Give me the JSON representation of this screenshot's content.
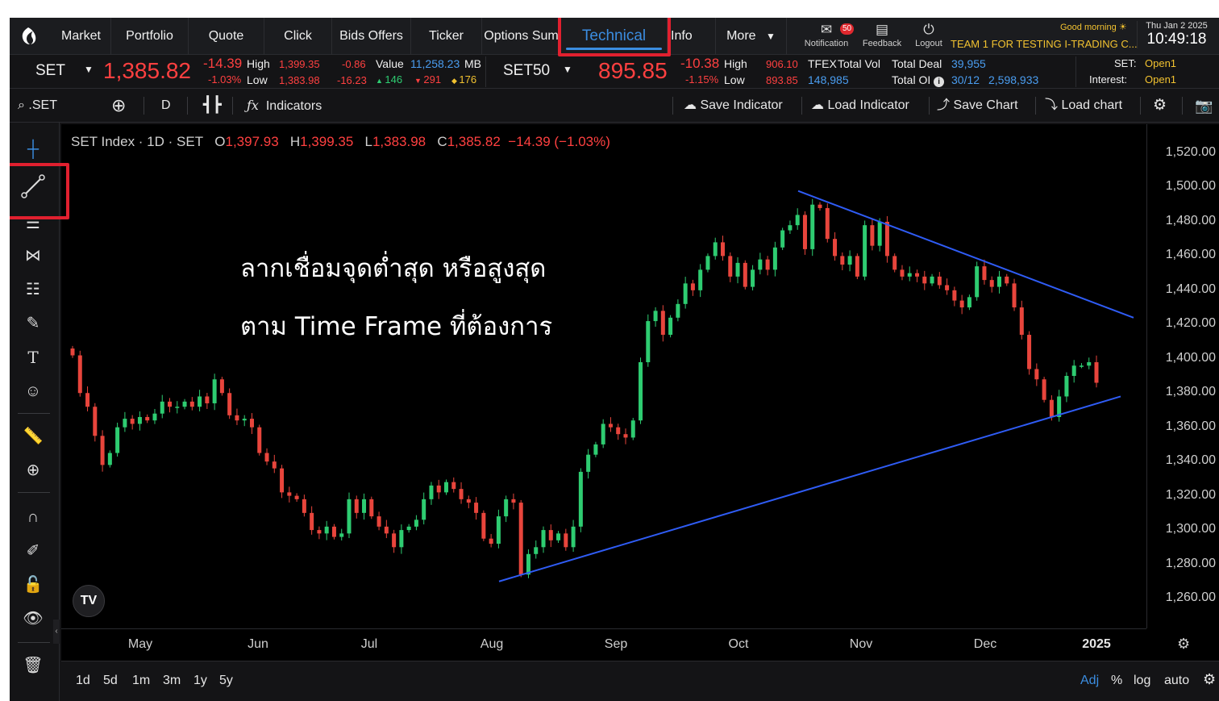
{
  "nav": {
    "items": [
      "Market",
      "Portfolio",
      "Quote",
      "Click",
      "Bids Offers",
      "Ticker",
      "Options Sum",
      "Technical",
      "Info",
      "More"
    ],
    "notification_label": "Notification",
    "notification_count": "50",
    "feedback_label": "Feedback",
    "logout_label": "Logout",
    "greeting": "Good morning",
    "team": "TEAM 1 FOR TESTING I-TRADING C...",
    "date": "Thu Jan 2 2025",
    "time": "10:49:18"
  },
  "quote": {
    "symbol": "SET",
    "last": "1,385.82",
    "change": "-14.39",
    "change_pct": "-1.03%",
    "high_label": "High",
    "high": "1,399.35",
    "low_label": "Low",
    "low": "1,383.98",
    "chg2": "-0.86",
    "chg3": "-16.23",
    "value_label": "Value",
    "value": "11,258.23",
    "value_unit": "MB",
    "up": "146",
    "down": "291",
    "unchanged": "176",
    "symbol2": "SET50",
    "last2": "895.85",
    "change2": "-10.38",
    "change2_pct": "-1.15%",
    "high2": "906.10",
    "low2": "893.85",
    "tfex_label": "TFEX",
    "total_vol_label": "Total Vol",
    "total_vol": "148,985",
    "total_deal_label": "Total Deal",
    "total_deal": "39,955",
    "total_oi_label": "Total OI",
    "total_oi_date": "30/12",
    "total_oi": "2,598,933",
    "set_label": "SET:",
    "set_status": "Open1",
    "interest_label": "Interest:",
    "interest_status": "Open1"
  },
  "toolbar": {
    "symbol_search": ".SET",
    "interval": "D",
    "indicators": "Indicators",
    "save_indicator": "Save Indicator",
    "load_indicator": "Load Indicator",
    "save_chart": "Save Chart",
    "load_chart": "Load chart"
  },
  "chart_legend": {
    "title": "SET Index · 1D · SET",
    "o_label": "O",
    "o": "1,397.93",
    "h_label": "H",
    "h": "1,399.35",
    "l_label": "L",
    "l": "1,383.98",
    "c_label": "C",
    "c": "1,385.82",
    "chg": "−14.39 (−1.03%)"
  },
  "overlay_text": {
    "line1": "ลากเชื่อมจุดต่ำสุด  หรือสูงสุด",
    "line2": "ตาม Time Frame ที่ต้องการ"
  },
  "chart_data": {
    "type": "candlestick",
    "title": "SET Index · 1D · SET",
    "x_ticks": [
      "May",
      "Jun",
      "Jul",
      "Aug",
      "Sep",
      "Oct",
      "Nov",
      "Dec",
      "2025"
    ],
    "y_ticks": [
      "1,520.00",
      "1,500.00",
      "1,480.00",
      "1,460.00",
      "1,440.00",
      "1,420.00",
      "1,400.00",
      "1,380.00",
      "1,360.00",
      "1,340.00",
      "1,320.00",
      "1,300.00",
      "1,280.00",
      "1,260.00"
    ],
    "ylim": [
      1248,
      1528
    ],
    "close_series": [
      1402,
      1380,
      1372,
      1355,
      1338,
      1345,
      1360,
      1365,
      1362,
      1366,
      1364,
      1368,
      1375,
      1372,
      1372,
      1375,
      1372,
      1378,
      1374,
      1388,
      1380,
      1367,
      1364,
      1365,
      1360,
      1345,
      1340,
      1336,
      1322,
      1320,
      1318,
      1310,
      1300,
      1298,
      1302,
      1296,
      1298,
      1318,
      1310,
      1318,
      1308,
      1302,
      1298,
      1290,
      1300,
      1302,
      1306,
      1318,
      1326,
      1322,
      1328,
      1324,
      1318,
      1316,
      1310,
      1295,
      1292,
      1308,
      1318,
      1316,
      1274,
      1286,
      1290,
      1300,
      1294,
      1298,
      1290,
      1302,
      1334,
      1344,
      1350,
      1362,
      1360,
      1356,
      1354,
      1364,
      1398,
      1422,
      1428,
      1414,
      1424,
      1432,
      1444,
      1440,
      1452,
      1460,
      1468,
      1460,
      1448,
      1456,
      1442,
      1452,
      1458,
      1452,
      1465,
      1475,
      1478,
      1484,
      1464,
      1490,
      1488,
      1470,
      1460,
      1455,
      1460,
      1448,
      1478,
      1466,
      1480,
      1460,
      1452,
      1448,
      1450,
      1448,
      1444,
      1448,
      1443,
      1440,
      1434,
      1430,
      1436,
      1454,
      1446,
      1442,
      1448,
      1444,
      1430,
      1414,
      1394,
      1388,
      1376,
      1366,
      1378,
      1390,
      1396,
      1396,
      1398,
      1386
    ],
    "trendlines": [
      {
        "from": [
          "2024-10-14",
          1498
        ],
        "to": [
          "2025-01-10",
          1424
        ]
      },
      {
        "from": [
          "2024-08-05",
          1270
        ],
        "to": [
          "2025-01-08",
          1378
        ]
      }
    ],
    "colors": {
      "up": "#2ecc71",
      "down": "#e8453c",
      "trendline": "#2f5cf5"
    }
  },
  "bottom": {
    "ranges": [
      "1d",
      "5d",
      "1m",
      "3m",
      "1y",
      "5y"
    ],
    "adj": "Adj",
    "pct": "%",
    "log": "log",
    "auto": "auto"
  },
  "tv_logo": "TV"
}
